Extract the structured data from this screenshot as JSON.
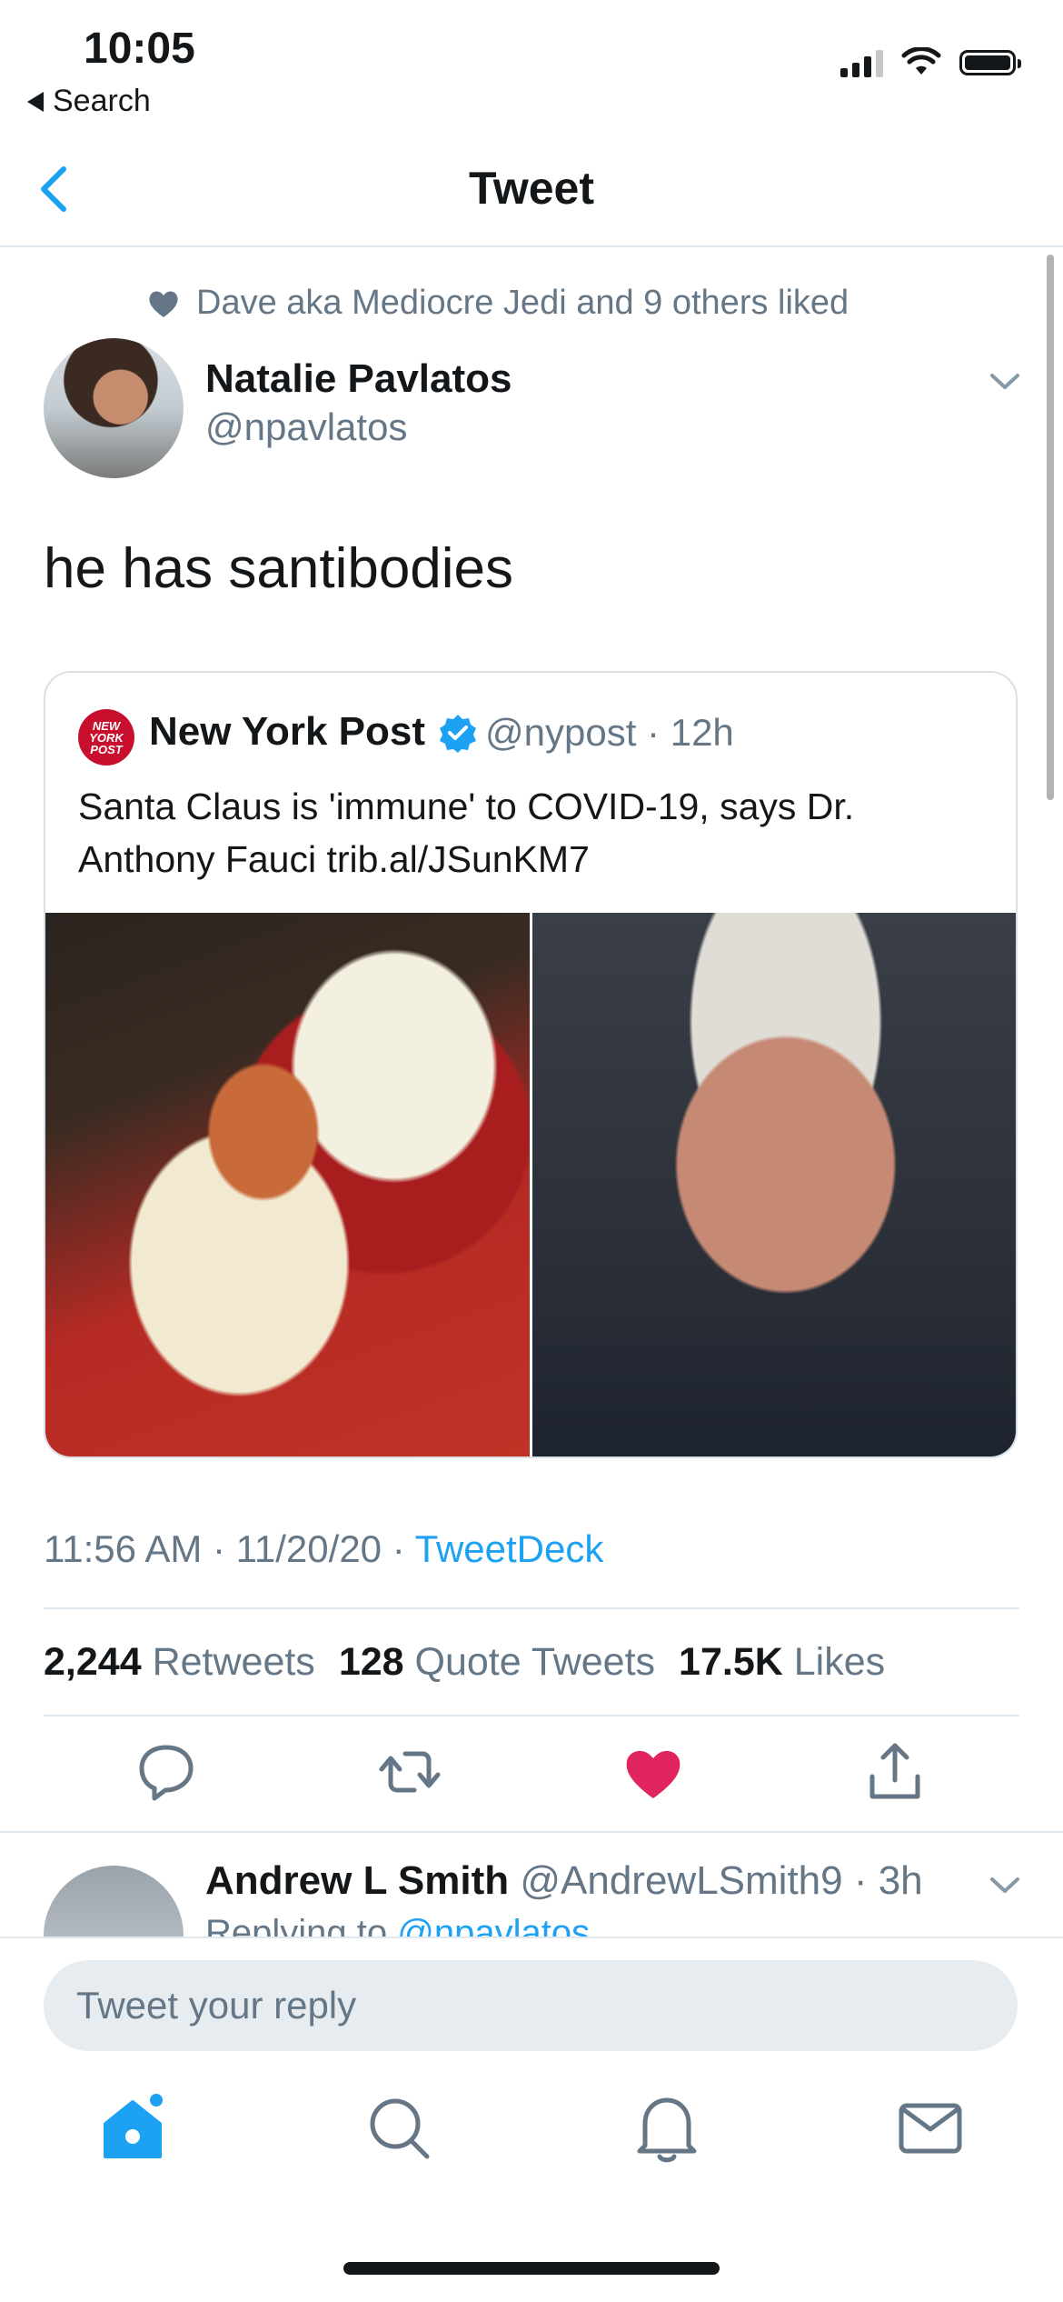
{
  "status_bar": {
    "time": "10:05",
    "back_label": "Search"
  },
  "header": {
    "title": "Tweet"
  },
  "social_context": "Dave aka Mediocre Jedi and 9 others liked",
  "tweet": {
    "author_name": "Natalie Pavlatos",
    "author_handle": "@npavlatos",
    "text": "he has santibodies",
    "time": "11:56 AM · 11/20/20 · ",
    "source": "TweetDeck"
  },
  "quoted_tweet": {
    "logo_text": "NEW YORK POST",
    "author_name": "New York Post",
    "author_handle": "@nypost · 12h",
    "text": "Santa Claus is 'immune' to COVID-19, says Dr. Anthony Fauci trib.al/JSunKM7"
  },
  "stats": [
    {
      "value": "2,244",
      "label": "Retweets"
    },
    {
      "value": "128",
      "label": "Quote Tweets"
    },
    {
      "value": "17.5K",
      "label": "Likes"
    }
  ],
  "actions": [
    {
      "icon": "reply-icon"
    },
    {
      "icon": "retweet-icon"
    },
    {
      "icon": "like-icon",
      "color": "#e0245e"
    },
    {
      "icon": "share-icon"
    }
  ],
  "reply": {
    "author_name": "Andrew L Smith",
    "author_meta": "@AndrewLSmith9 · 3h",
    "replying_prefix": "Replying to ",
    "replying_to": "@npavlatos"
  },
  "composer": {
    "placeholder": "Tweet your reply"
  },
  "tabbar": [
    "home-icon",
    "search-icon",
    "notifications-icon",
    "messages-icon"
  ],
  "colors": {
    "accent": "#1da1f2",
    "like": "#e0245e",
    "secondary_text": "#657786"
  }
}
